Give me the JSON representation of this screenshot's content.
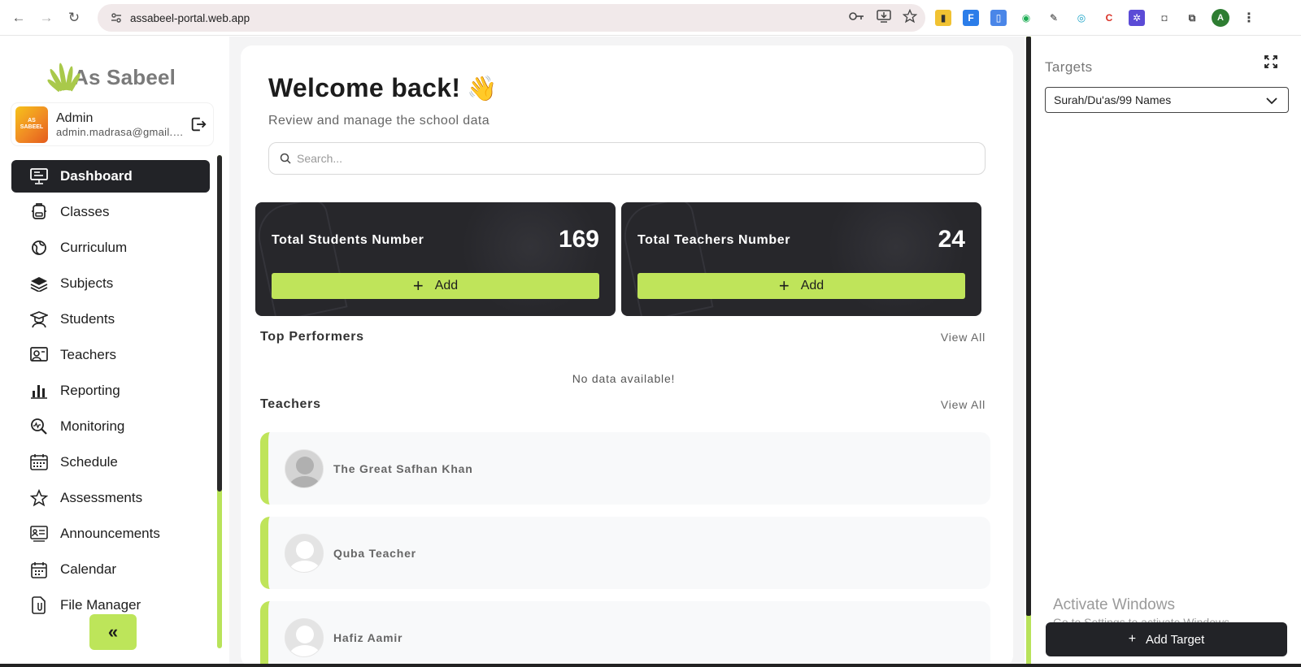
{
  "browser": {
    "url": "assabeel-portal.web.app",
    "back_icon": "←",
    "forward_icon": "→",
    "reload_icon": "↻"
  },
  "brand": {
    "name": "As Sabeel"
  },
  "profile": {
    "name": "Admin",
    "email": "admin.madrasa@gmail.com",
    "pic_text": "AS SABEEL"
  },
  "sidebar": {
    "items": [
      {
        "label": "Dashboard",
        "icon": "dashboard-icon",
        "active": true
      },
      {
        "label": "Classes",
        "icon": "classes-icon"
      },
      {
        "label": "Curriculum",
        "icon": "curriculum-icon"
      },
      {
        "label": "Subjects",
        "icon": "subjects-icon"
      },
      {
        "label": "Students",
        "icon": "students-icon"
      },
      {
        "label": "Teachers",
        "icon": "teachers-icon"
      },
      {
        "label": "Reporting",
        "icon": "reporting-icon"
      },
      {
        "label": "Monitoring",
        "icon": "monitoring-icon"
      },
      {
        "label": "Schedule",
        "icon": "schedule-icon"
      },
      {
        "label": "Assessments",
        "icon": "assessments-icon"
      },
      {
        "label": "Announcements",
        "icon": "announcements-icon"
      },
      {
        "label": "Calendar",
        "icon": "calendar-icon"
      },
      {
        "label": "File Manager",
        "icon": "file-manager-icon"
      }
    ],
    "collapse_label": "«"
  },
  "main": {
    "welcome": "Welcome back!",
    "wave": "👋",
    "subtitle": "Review and manage the school data",
    "search_placeholder": "Search...",
    "stats": [
      {
        "label": "Total Students Number",
        "value": "169",
        "add_label": "Add"
      },
      {
        "label": "Total Teachers Number",
        "value": "24",
        "add_label": "Add"
      }
    ],
    "top_performers": {
      "title": "Top Performers",
      "view_all": "View All",
      "empty": "No data available!"
    },
    "teachers": {
      "title": "Teachers",
      "view_all": "View All",
      "list": [
        "The Great Safhan Khan",
        "Quba Teacher",
        "Hafiz Aamir"
      ]
    }
  },
  "targets": {
    "title": "Targets",
    "selected": "Surah/Du'as/99 Names",
    "add_label": "Add Target"
  },
  "watermark": {
    "line1": "Activate Windows",
    "line2": "Go to Settings to activate Windows."
  },
  "colors": {
    "accent": "#bfe45a",
    "dark": "#222327"
  }
}
